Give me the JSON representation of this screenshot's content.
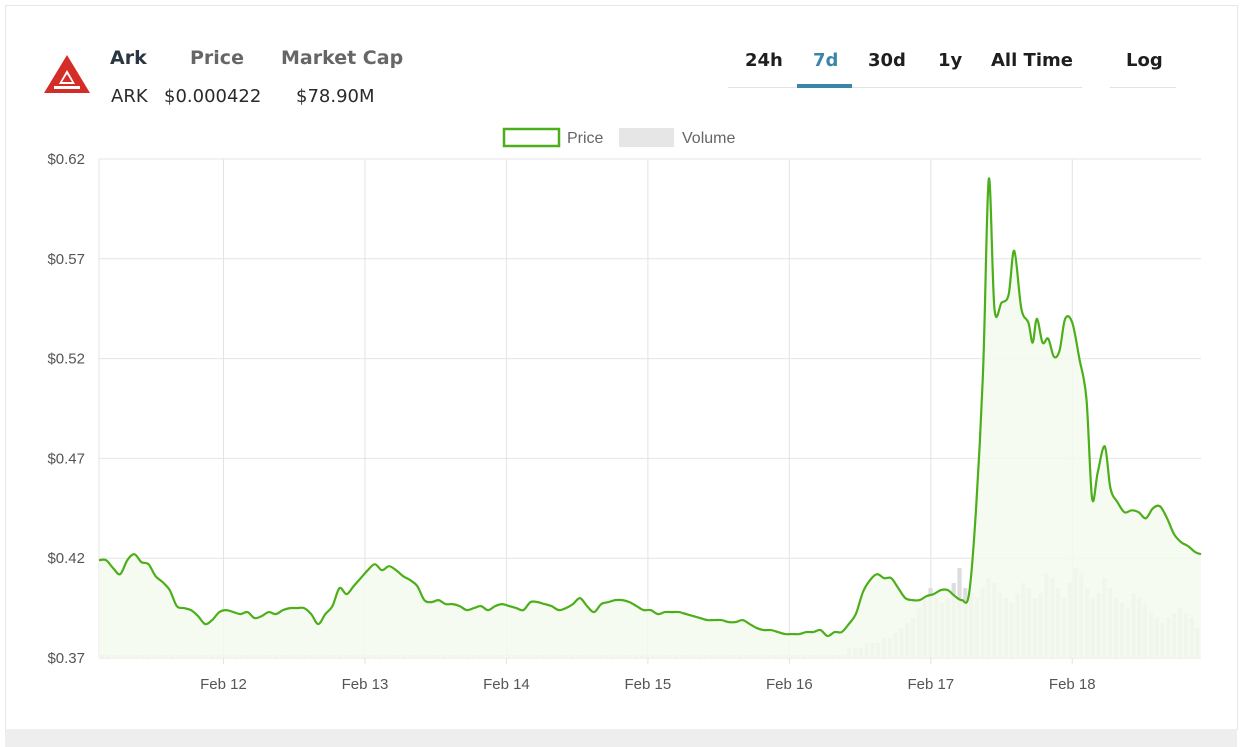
{
  "header": {
    "name": "Ark",
    "price_label": "Price",
    "market_cap_label": "Market Cap",
    "symbol": "ARK",
    "price": "$0.000422",
    "market_cap": "$78.90M"
  },
  "ranges": {
    "tabs": [
      "24h",
      "7d",
      "30d",
      "1y",
      "All Time"
    ],
    "active": "7d",
    "log_label": "Log"
  },
  "colors": {
    "accent": "#3a86a8",
    "price_line": "#4caf1a",
    "price_fill": "#f3faee",
    "volume": "#dddddd",
    "logo_red": "#d42d27"
  },
  "chart_data": {
    "type": "line",
    "legend": [
      "Price",
      "Volume"
    ],
    "legend_position": "top-center",
    "grid": true,
    "ylim": [
      0.37,
      0.62
    ],
    "y_ticks": [
      "$0.62",
      "$0.57",
      "$0.52",
      "$0.47",
      "$0.42",
      "$0.37"
    ],
    "y_tick_values": [
      0.62,
      0.57,
      0.52,
      0.47,
      0.42,
      0.37
    ],
    "x_ticks": [
      "Feb 12",
      "Feb 13",
      "Feb 14",
      "Feb 15",
      "Feb 16",
      "Feb 17",
      "Feb 18"
    ],
    "x_tick_days": [
      12,
      13,
      14,
      15,
      16,
      17,
      18
    ],
    "xlim_days": [
      11.12,
      18.91
    ],
    "series": [
      {
        "name": "Price",
        "points": [
          [
            11.12,
            0.419
          ],
          [
            11.17,
            0.419
          ],
          [
            11.22,
            0.415
          ],
          [
            11.27,
            0.412
          ],
          [
            11.32,
            0.419
          ],
          [
            11.37,
            0.422
          ],
          [
            11.42,
            0.418
          ],
          [
            11.47,
            0.417
          ],
          [
            11.52,
            0.411
          ],
          [
            11.57,
            0.408
          ],
          [
            11.62,
            0.404
          ],
          [
            11.67,
            0.396
          ],
          [
            11.72,
            0.395
          ],
          [
            11.77,
            0.394
          ],
          [
            11.82,
            0.391
          ],
          [
            11.87,
            0.387
          ],
          [
            11.92,
            0.389
          ],
          [
            11.97,
            0.393
          ],
          [
            12.02,
            0.394
          ],
          [
            12.07,
            0.393
          ],
          [
            12.12,
            0.392
          ],
          [
            12.17,
            0.393
          ],
          [
            12.22,
            0.39
          ],
          [
            12.27,
            0.391
          ],
          [
            12.32,
            0.393
          ],
          [
            12.37,
            0.392
          ],
          [
            12.42,
            0.394
          ],
          [
            12.47,
            0.395
          ],
          [
            12.52,
            0.395
          ],
          [
            12.57,
            0.395
          ],
          [
            12.62,
            0.392
          ],
          [
            12.67,
            0.387
          ],
          [
            12.72,
            0.392
          ],
          [
            12.77,
            0.396
          ],
          [
            12.82,
            0.405
          ],
          [
            12.87,
            0.402
          ],
          [
            12.92,
            0.406
          ],
          [
            12.97,
            0.41
          ],
          [
            13.02,
            0.414
          ],
          [
            13.07,
            0.417
          ],
          [
            13.12,
            0.414
          ],
          [
            13.17,
            0.416
          ],
          [
            13.22,
            0.414
          ],
          [
            13.27,
            0.411
          ],
          [
            13.32,
            0.409
          ],
          [
            13.37,
            0.406
          ],
          [
            13.42,
            0.399
          ],
          [
            13.47,
            0.398
          ],
          [
            13.52,
            0.399
          ],
          [
            13.57,
            0.397
          ],
          [
            13.62,
            0.397
          ],
          [
            13.67,
            0.396
          ],
          [
            13.72,
            0.394
          ],
          [
            13.77,
            0.395
          ],
          [
            13.82,
            0.396
          ],
          [
            13.87,
            0.394
          ],
          [
            13.92,
            0.396
          ],
          [
            13.97,
            0.397
          ],
          [
            14.02,
            0.396
          ],
          [
            14.07,
            0.395
          ],
          [
            14.12,
            0.394
          ],
          [
            14.17,
            0.398
          ],
          [
            14.22,
            0.398
          ],
          [
            14.27,
            0.397
          ],
          [
            14.32,
            0.396
          ],
          [
            14.37,
            0.394
          ],
          [
            14.42,
            0.395
          ],
          [
            14.47,
            0.397
          ],
          [
            14.52,
            0.4
          ],
          [
            14.57,
            0.396
          ],
          [
            14.62,
            0.393
          ],
          [
            14.67,
            0.397
          ],
          [
            14.72,
            0.398
          ],
          [
            14.77,
            0.399
          ],
          [
            14.82,
            0.399
          ],
          [
            14.87,
            0.398
          ],
          [
            14.92,
            0.396
          ],
          [
            14.97,
            0.394
          ],
          [
            15.02,
            0.394
          ],
          [
            15.07,
            0.392
          ],
          [
            15.12,
            0.393
          ],
          [
            15.17,
            0.393
          ],
          [
            15.22,
            0.393
          ],
          [
            15.27,
            0.392
          ],
          [
            15.32,
            0.391
          ],
          [
            15.37,
            0.39
          ],
          [
            15.42,
            0.389
          ],
          [
            15.47,
            0.389
          ],
          [
            15.52,
            0.389
          ],
          [
            15.57,
            0.388
          ],
          [
            15.62,
            0.388
          ],
          [
            15.67,
            0.389
          ],
          [
            15.72,
            0.387
          ],
          [
            15.77,
            0.385
          ],
          [
            15.82,
            0.384
          ],
          [
            15.87,
            0.384
          ],
          [
            15.92,
            0.383
          ],
          [
            15.97,
            0.382
          ],
          [
            16.02,
            0.382
          ],
          [
            16.07,
            0.382
          ],
          [
            16.12,
            0.383
          ],
          [
            16.17,
            0.383
          ],
          [
            16.22,
            0.384
          ],
          [
            16.27,
            0.381
          ],
          [
            16.32,
            0.383
          ],
          [
            16.37,
            0.383
          ],
          [
            16.42,
            0.387
          ],
          [
            16.47,
            0.392
          ],
          [
            16.52,
            0.403
          ],
          [
            16.57,
            0.409
          ],
          [
            16.62,
            0.412
          ],
          [
            16.67,
            0.41
          ],
          [
            16.72,
            0.41
          ],
          [
            16.77,
            0.405
          ],
          [
            16.82,
            0.4
          ],
          [
            16.87,
            0.399
          ],
          [
            16.92,
            0.399
          ],
          [
            16.97,
            0.401
          ],
          [
            17.02,
            0.402
          ],
          [
            17.07,
            0.404
          ],
          [
            17.12,
            0.404
          ],
          [
            17.17,
            0.401
          ],
          [
            17.22,
            0.399
          ],
          [
            17.27,
            0.402
          ],
          [
            17.32,
            0.445
          ],
          [
            17.37,
            0.515
          ],
          [
            17.41,
            0.61
          ],
          [
            17.45,
            0.545
          ],
          [
            17.5,
            0.548
          ],
          [
            17.55,
            0.552
          ],
          [
            17.59,
            0.574
          ],
          [
            17.64,
            0.545
          ],
          [
            17.69,
            0.538
          ],
          [
            17.72,
            0.528
          ],
          [
            17.75,
            0.54
          ],
          [
            17.79,
            0.528
          ],
          [
            17.83,
            0.53
          ],
          [
            17.87,
            0.521
          ],
          [
            17.91,
            0.524
          ],
          [
            17.95,
            0.54
          ],
          [
            18.0,
            0.538
          ],
          [
            18.05,
            0.52
          ],
          [
            18.1,
            0.5
          ],
          [
            18.14,
            0.45
          ],
          [
            18.18,
            0.463
          ],
          [
            18.23,
            0.476
          ],
          [
            18.27,
            0.455
          ],
          [
            18.32,
            0.448
          ],
          [
            18.37,
            0.443
          ],
          [
            18.42,
            0.444
          ],
          [
            18.47,
            0.443
          ],
          [
            18.52,
            0.44
          ],
          [
            18.57,
            0.445
          ],
          [
            18.62,
            0.446
          ],
          [
            18.67,
            0.44
          ],
          [
            18.72,
            0.432
          ],
          [
            18.77,
            0.428
          ],
          [
            18.82,
            0.426
          ],
          [
            18.87,
            0.423
          ],
          [
            18.91,
            0.422
          ]
        ]
      },
      {
        "name": "Volume",
        "relative_heights_recent": [
          0.02,
          0.02,
          0.02,
          0.03,
          0.03,
          0.03,
          0.04,
          0.04,
          0.05,
          0.06,
          0.07,
          0.08,
          0.1,
          0.12,
          0.14,
          0.12,
          0.11,
          0.12,
          0.15,
          0.18,
          0.14,
          0.13,
          0.12,
          0.14,
          0.16,
          0.15,
          0.13,
          0.12,
          0.11,
          0.13,
          0.15,
          0.14,
          0.12,
          0.13,
          0.17,
          0.16,
          0.14,
          0.12,
          0.15,
          0.18,
          0.17,
          0.14,
          0.12,
          0.13,
          0.16,
          0.14,
          0.12,
          0.11,
          0.1,
          0.13,
          0.12,
          0.11,
          0.09,
          0.08,
          0.07,
          0.08,
          0.09,
          0.1,
          0.09,
          0.08,
          0.06
        ]
      }
    ]
  }
}
